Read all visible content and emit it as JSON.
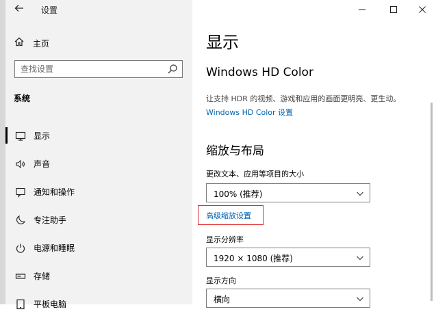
{
  "window": {
    "title": "设置",
    "back_icon": "arrow-left-icon"
  },
  "sidebar": {
    "home_label": "主页",
    "search_placeholder": "查找设置",
    "section_title": "系统",
    "items": [
      {
        "label": "显示",
        "icon": "display-icon",
        "active": true
      },
      {
        "label": "声音",
        "icon": "speaker-icon",
        "active": false
      },
      {
        "label": "通知和操作",
        "icon": "notification-icon",
        "active": false
      },
      {
        "label": "专注助手",
        "icon": "moon-icon",
        "active": false
      },
      {
        "label": "电源和睡眠",
        "icon": "power-icon",
        "active": false
      },
      {
        "label": "存储",
        "icon": "storage-icon",
        "active": false
      },
      {
        "label": "平板电脑",
        "icon": "tablet-icon",
        "active": false
      }
    ]
  },
  "main": {
    "title": "显示",
    "hdr": {
      "heading": "Windows HD Color",
      "description": "让支持 HDR 的视频、游戏和应用的画面更明亮、更生动。",
      "link": "Windows HD Color 设置"
    },
    "scale": {
      "heading": "缩放与布局",
      "size_label": "更改文本、应用等项目的大小",
      "size_value": "100% (推荐)",
      "advanced_link": "高级缩放设置",
      "resolution_label": "显示分辨率",
      "resolution_value": "1920 × 1080 (推荐)",
      "orientation_label": "显示方向",
      "orientation_value": "横向"
    }
  },
  "colors": {
    "link": "#0063b1",
    "highlight_box": "#e03030",
    "sidebar_bg": "#f2f2f2"
  }
}
